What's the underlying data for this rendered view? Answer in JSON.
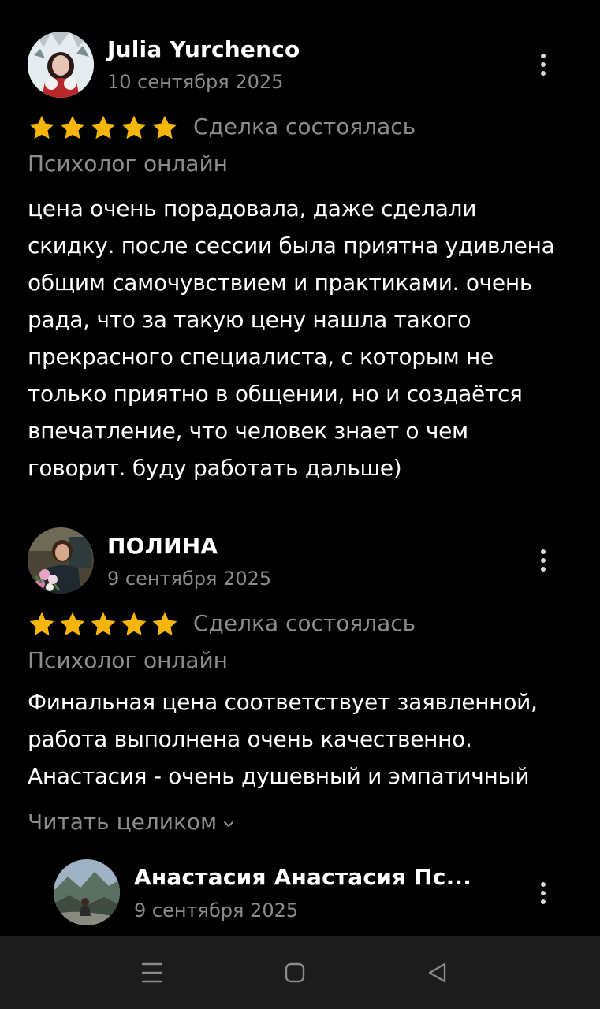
{
  "reviews": [
    {
      "author": "Julia Yurchenco",
      "date": "10 сентября 2025",
      "rating": 5,
      "deal_status": "Сделка состоялась",
      "category": "Психолог онлайн",
      "text_lines": [
        "цена очень порадовала, даже сделали",
        "скидку. после сессии была приятна удивлена",
        "общим самочувствием и практиками. очень",
        "рада, что за такую цену нашла такого",
        "прекрасного специалиста, с которым не",
        "только приятно в общении, но и создаётся",
        "впечатление, что человек знает о чем",
        "говорит. буду работать дальше)"
      ]
    },
    {
      "author": "ПОЛИНА",
      "date": "9 сентября 2025",
      "rating": 5,
      "deal_status": "Сделка состоялась",
      "category": "Психолог онлайн",
      "text_lines": [
        "Финальная цена соответствует заявленной,",
        "работа выполнена очень качественно.",
        "Анастасия - очень душевный и эмпатичный"
      ],
      "read_more": "Читать целиком"
    }
  ],
  "reply": {
    "author": "Анастасия Анастасия Пс...",
    "date": "9 сентября 2025"
  },
  "colors": {
    "background": "#000000",
    "star": "#f5b50a",
    "secondary_text": "#8c8c8c",
    "navbar": "#1c1c1c"
  },
  "icons": {
    "star": "star-icon",
    "more": "more-vertical-icon",
    "chevron": "chevron-down-icon",
    "nav_recents": "recents-icon",
    "nav_home": "home-icon",
    "nav_back": "back-icon"
  }
}
